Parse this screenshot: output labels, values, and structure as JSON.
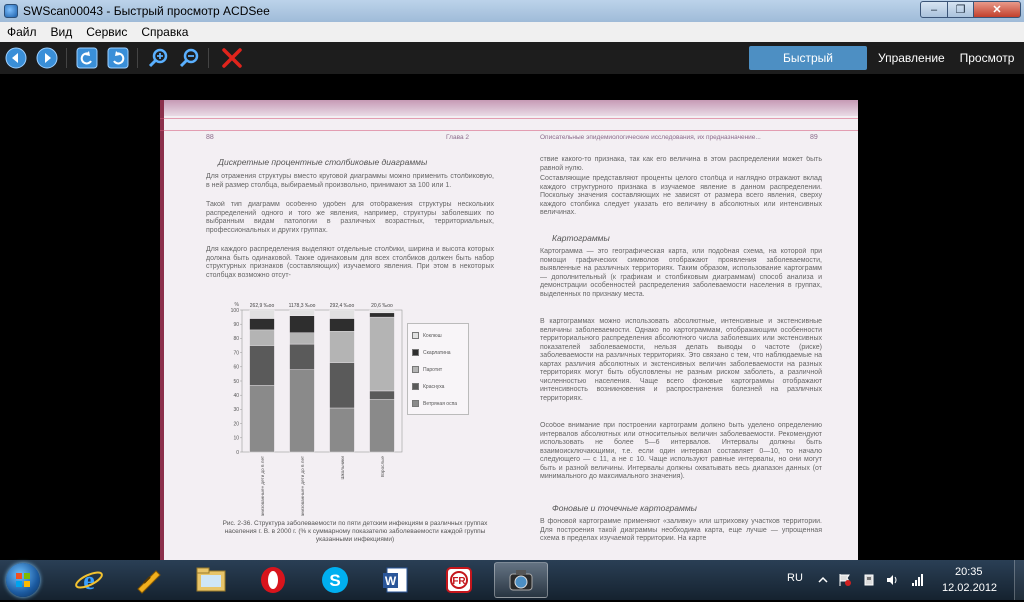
{
  "window": {
    "title": "SWScan00043 - Быстрый просмотр ACDSee",
    "controls": {
      "minimize": "–",
      "maximize": "❐",
      "close": "✕"
    }
  },
  "menu": [
    "Файл",
    "Вид",
    "Сервис",
    "Справка"
  ],
  "toolbar": {
    "icons": [
      "back-arrow",
      "forward-arrow",
      "rotate-left",
      "rotate-right",
      "zoom-in",
      "zoom-out",
      "delete"
    ],
    "modes": [
      "Быстрый просмотр",
      "Управление",
      "Просмотр"
    ],
    "active_mode_color": "#4d8fc3"
  },
  "scan": {
    "left_page_num": "88",
    "left_running_head": "Глава 2",
    "right_running_head": "Описательные эпидемиологические исследования, их предназначение...",
    "right_page_num": "89",
    "left_section_heading": "Дискретные процентные столбиковые диаграммы",
    "left_paragraphs": [
      "Для отражения структуры вместо круговой диаграммы можно применить столбиковую, в ней размер столбца, выбираемый произвольно, принимают за 100 или 1.",
      "Такой тип диаграмм особенно удобен для отображения структуры нескольких распределений одного и того же явления, например, структуры заболевших по выбранным видам патологии в различных возрастных, территориальных, профессиональных и других группах.",
      "Для каждого распределения выделяют отдельные столбики, ширина и высота которых должна быть одинаковой. Также одинаковым для всех столбиков должен быть набор структурных признаков (составляющих) изучаемого явления. При этом в некоторых столбцах возможно отсут-"
    ],
    "figure_caption": "Рис. 2-36. Структура заболеваемости по пяти детским инфекциям в различных группах населения г. В. в 2000 г. (% к суммарному показателю заболеваемости каждой группы указанными инфекциями)",
    "right_paragraphs": [
      "ствие какого-то признака, так как его величина в этом распределении может быть равной нулю.",
      "Составляющие представляют проценты целого столбца и наглядно отражают вклад каждого структурного признака в изучаемое явление в данном распределении. Поскольку значения составляющих не зависят от размера всего явления, сверху каждого столбика следует указать его величину в абсолютных или интенсивных величинах."
    ],
    "right_section_heading_1": "Картограммы",
    "right_paragraphs_2": [
      "Картограмма — это географическая карта, или подобная схема, на которой при помощи графических символов отображают проявления заболеваемости, выявленные на различных территориях. Таким образом, использование картограмм — дополнительный (к графикам и столбиковым диаграммам) способ анализа и демонстрации особенностей распределения заболеваемости населения в группах, выделенных по признаку места.",
      "В картограммах можно использовать абсолютные, интенсивные и экстенсивные величины заболеваемости. Однако по картограммам, отображающим особенности территориального распределения абсолютного числа заболевших или экстенсивных показателей заболеваемости, нельзя делать выводы о частоте (риске) заболеваемости на различных территориях. Это связано с тем, что наблюдаемые на картах различия абсолютных и экстенсивных величин заболеваемости на разных территориях могут быть обусловлены не разным риском заболеть, а различной численностью населения. Чаще всего фоновые картограммы отображают интенсивность возникновения и распространения болезней на различных территориях.",
      "Особое внимание при построении картограмм должно быть уделено определению интервалов абсолютных или относительных величин заболеваемости. Рекомендуют использовать не более 5—6 интервалов. Интервалы должны быть взаимоисключающими, т.е. если один интервал составляет 0—10, то начало следующего — с 11, а не с 10. Чаще используют равные интервалы, но они могут быть и разной величины. Интервалы должны охватывать весь диапазон данных (от минимального до максимального значения)."
    ],
    "right_section_heading_2": "Фоновые и точечные картограммы",
    "right_paragraphs_3": [
      "В фоновой картограмме применяют «заливку» или штриховку участков территории. Для построения такой диаграммы необходима карта, еще лучше — упрощенная схема в пределах изучаемой территории. На карте"
    ]
  },
  "chart_data": {
    "type": "bar",
    "stacked": true,
    "y_unit_label": "%",
    "ylim": [
      0,
      100
    ],
    "yticks": [
      "0",
      "10",
      "20",
      "30",
      "40",
      "50",
      "60",
      "70",
      "80",
      "90",
      "100"
    ],
    "categories": [
      "«Неорганизованные» дети до 6 лет",
      "«Организованные» дети до 6 лет",
      "Школьники",
      "Взрослые"
    ],
    "bar_totals": [
      "262,9 ‰оо",
      "1178,3 ‰оо",
      "292,4 ‰оо",
      "20,6 ‰оо"
    ],
    "series": [
      {
        "name": "Ветряная оспа",
        "color": "#8a8a8a",
        "values": [
          47,
          58,
          31,
          37
        ]
      },
      {
        "name": "Краснуха",
        "color": "#5a5a5a",
        "values": [
          28,
          18,
          32,
          6
        ]
      },
      {
        "name": "Паротит",
        "color": "#b4b4b4",
        "values": [
          11,
          8,
          22,
          52
        ]
      },
      {
        "name": "Скарлатина",
        "color": "#2e2e2e",
        "values": [
          8,
          12,
          9,
          3
        ]
      },
      {
        "name": "Коклюш",
        "color": "#e1e1e1",
        "values": [
          6,
          4,
          6,
          2
        ]
      }
    ],
    "legend_order": [
      "Коклюш",
      "Скарлатина",
      "Паротит",
      "Краснуха",
      "Ветряная оспа"
    ]
  },
  "taskbar": {
    "apps": [
      "internet-explorer",
      "ftp-client",
      "file-explorer",
      "opera",
      "skype",
      "word",
      "finereader",
      "acdsee"
    ],
    "language": "RU",
    "time": "20:35",
    "date": "12.02.2012"
  }
}
